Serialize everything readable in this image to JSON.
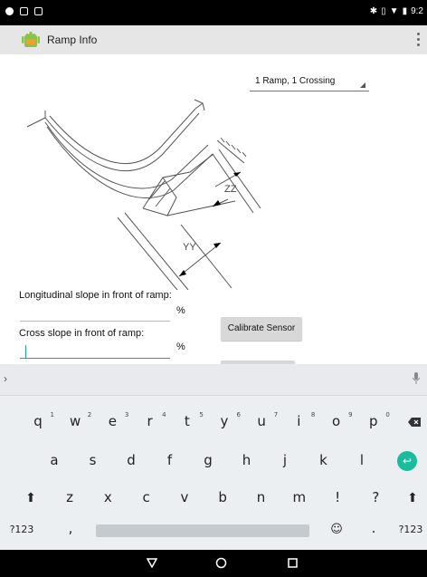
{
  "status_bar": {
    "time": "9:2"
  },
  "app_bar": {
    "title": "Ramp Info",
    "overflow_icon": "more-vert-icon"
  },
  "spinner": {
    "selected": "1 Ramp, 1 Crossing"
  },
  "diagram": {
    "label_zz": "ZZ",
    "label_yy": "YY"
  },
  "form": {
    "longitudinal_label": "Longitudinal slope in front of ramp:",
    "longitudinal_value": "",
    "longitudinal_unit": "%",
    "cross_label": "Cross slope in front of ramp:",
    "cross_value": "",
    "cross_unit": "%",
    "calibrate_label": "Calibrate Sensor"
  },
  "keyboard": {
    "row1": [
      {
        "key": "q",
        "hint": "1"
      },
      {
        "key": "w",
        "hint": "2"
      },
      {
        "key": "e",
        "hint": "3"
      },
      {
        "key": "r",
        "hint": "4"
      },
      {
        "key": "t",
        "hint": "5"
      },
      {
        "key": "y",
        "hint": "6"
      },
      {
        "key": "u",
        "hint": "7"
      },
      {
        "key": "i",
        "hint": "8"
      },
      {
        "key": "o",
        "hint": "9"
      },
      {
        "key": "p",
        "hint": "0"
      }
    ],
    "row2": [
      "a",
      "s",
      "d",
      "f",
      "g",
      "h",
      "j",
      "k",
      "l"
    ],
    "row3": [
      "z",
      "x",
      "c",
      "v",
      "b",
      "n",
      "m",
      "!",
      "?"
    ],
    "symbols_key": "?123",
    "comma_key": ",",
    "period_key": ".",
    "symbols_key_right": "?123",
    "enter_color": "#1abc9c"
  },
  "navigation": {
    "back": "back-icon",
    "home": "home-icon",
    "recents": "recents-icon"
  }
}
